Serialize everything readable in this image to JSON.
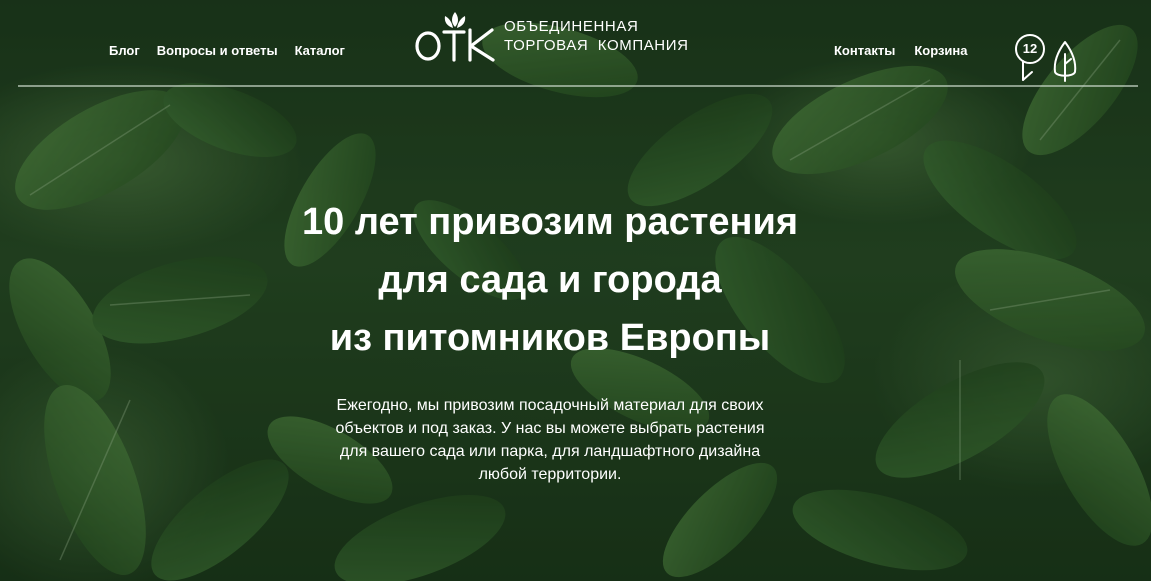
{
  "header": {
    "nav_left": [
      {
        "label": "Блог"
      },
      {
        "label": "Вопросы и ответы"
      },
      {
        "label": "Каталог"
      }
    ],
    "logo": {
      "mark": "ОТК",
      "line1": "ОБЪЕДИНЕННАЯ",
      "line2": "ТОРГОВАЯ  КОМПАНИЯ"
    },
    "nav_right": [
      {
        "label": "Контакты"
      },
      {
        "label": "Корзина"
      }
    ],
    "cart_count": "12",
    "icons": {
      "cart": "cart-bubble-icon",
      "tree": "tree-icon",
      "lotus": "lotus-icon"
    }
  },
  "hero": {
    "title": "10  лет привозим  растения\nдля сада и города\nиз питомников Европы",
    "text": "Ежегодно, мы привозим  посадочный материал для своих\nобъектов и под заказ. У нас вы можете выбрать растения\nдля вашего сада или парка, для ландшафтного дизайна\nлюбой территории."
  },
  "colors": {
    "text": "#ffffff",
    "background_green": "#2b4f28",
    "divider": "#c8d7c8"
  }
}
